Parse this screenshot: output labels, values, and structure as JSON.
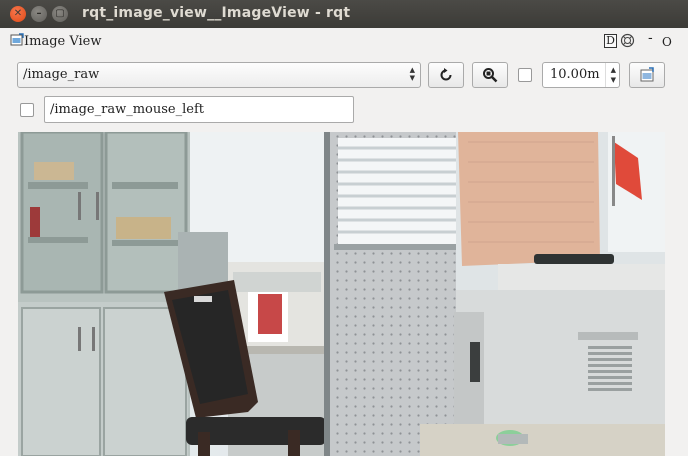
{
  "window": {
    "title": "rqt_image_view__ImageView - rqt",
    "close_glyph": "✕",
    "minimize_glyph": "–",
    "maximize_glyph": "▢"
  },
  "dock": {
    "title": "Image View",
    "d_label": "D",
    "dash_label": "-",
    "o_label": "O"
  },
  "toolbar": {
    "topic_value": "/image_raw",
    "smooth_scaling_checked": false,
    "rotation_value": "10.00m",
    "icons": {
      "refresh": "refresh-icon",
      "zoom": "zoom-fit-icon",
      "save": "save-image-icon"
    }
  },
  "mouse_publish": {
    "checked": false,
    "topic_value": "/image_raw_mouse_left"
  },
  "colors": {
    "titlebar": "#3c3b37",
    "window_bg": "#f2f1f0",
    "close_button": "#df4a16"
  }
}
